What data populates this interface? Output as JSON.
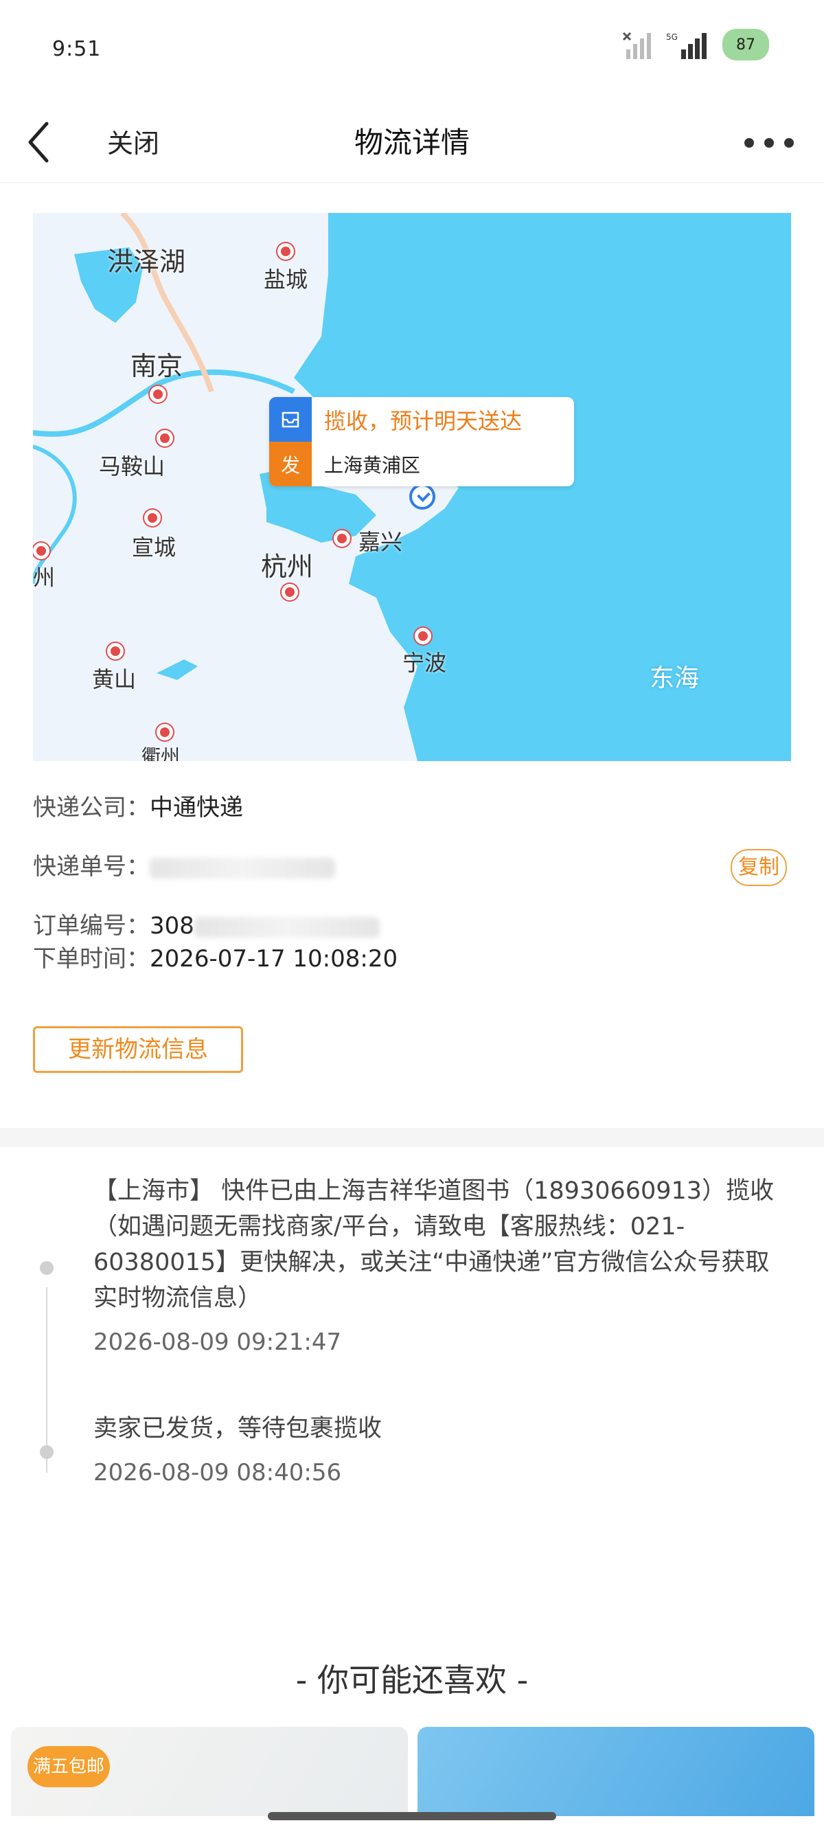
{
  "status_bar": {
    "time": "9:51",
    "battery": "87",
    "network": "5G"
  },
  "nav": {
    "close_label": "关闭",
    "title": "物流详情"
  },
  "map": {
    "popup": {
      "status": "揽收，预计明天送达",
      "send_badge": "发",
      "location": "上海黄浦区"
    },
    "labels": {
      "hongzehu": "洪泽湖",
      "yancheng": "盐城",
      "nanjing": "南京",
      "maanshan": "马鞍山",
      "xuancheng": "宣城",
      "hangzhou": "杭州",
      "jiaxing": "嘉兴",
      "huangshan": "黄山",
      "ningbo": "宁波",
      "donghai": "东海",
      "quzhou": "衢州",
      "partial_left": "州"
    }
  },
  "info": {
    "company_label": "快递公司：",
    "company_value": "中通快递",
    "tracking_label": "快递单号：",
    "copy_label": "复制",
    "order_label": "订单编号：",
    "order_value_visible": "308",
    "time_label": "下单时间：",
    "time_value": "2026-07-17 10:08:20"
  },
  "update_button": "更新物流信息",
  "timeline": [
    {
      "text": "【上海市】 快件已由上海吉祥华道图书（18930660913）揽收（如遇问题无需找商家/平台，请致电【客服热线：021-60380015】更快解决，或关注“中通快递”官方微信公众号获取实时物流信息）",
      "time": "2026-08-09 09:21:47"
    },
    {
      "text": "卖家已发货，等待包裹揽收",
      "time": "2026-08-09 08:40:56"
    }
  ],
  "recommend": {
    "title": "- 你可能还喜欢 -",
    "badge": "满五包邮"
  },
  "colors": {
    "accent": "#ef8a1d",
    "blue": "#2f7ee8",
    "sea": "#5bcff5"
  }
}
